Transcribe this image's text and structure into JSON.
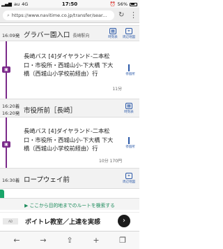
{
  "status_bar": {
    "carrier": "au",
    "network": "4G",
    "time": "17:50",
    "battery": "56%"
  },
  "browser": {
    "url": "https://www.navitime.co.jp/transfer/sear..."
  },
  "route": {
    "stations": [
      {
        "time": "16:09発",
        "name": "グラバー園入口",
        "sub": "長崎駅向",
        "icon_label": "時刻表"
      },
      {
        "time_arr": "16:20着",
        "time_dep": "16:20発",
        "name": "市役所前［長崎］",
        "icon_label": "時刻表"
      },
      {
        "time": "16:30着",
        "name": "ロープウェイ前",
        "icon_label": "周辺地図"
      }
    ],
    "station1_map_label": "周辺地図",
    "segments": [
      {
        "description": "長崎バス [4]ダイヤランド-二本松口・市役所・西城山小-下大橋 下大橋（西城山小学校前経由）行",
        "duration": "11分",
        "stops_label": "停留所"
      },
      {
        "description": "長崎バス [4]ダイヤランド-二本松口・市役所・西城山小-下大橋 下大橋（西城山小学校前経由）行",
        "duration": "10分 170円",
        "stops_label": "停留所"
      }
    ]
  },
  "link_bar": {
    "text": "ここから目的地までのルートを検索する"
  },
  "ad": {
    "logo": "AD",
    "text": "ボイトレ教室／上達を実感",
    "go": "›"
  },
  "toolbar": {
    "back": "←",
    "forward": "→",
    "share": "⇪",
    "tabs_add": "+",
    "tabs": "❐"
  },
  "colors": {
    "bus_line": "#7b2a8a",
    "link_green": "#1a8a5a",
    "icon_blue": "#2a58a8"
  }
}
